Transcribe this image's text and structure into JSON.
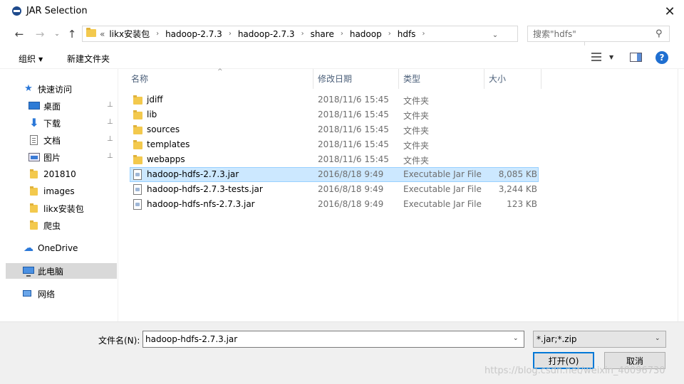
{
  "window": {
    "title": "JAR Selection",
    "close_glyph": "✕"
  },
  "nav": {
    "back_glyph": "←",
    "forward_glyph": "→",
    "recent_glyph": "⌄",
    "up_glyph": "↑",
    "refresh_glyph": "↻",
    "dropdown_glyph": "⌄"
  },
  "address": {
    "more_glyph": "«",
    "separator": "›",
    "crumbs": [
      "likx安装包",
      "hadoop-2.7.3",
      "hadoop-2.7.3",
      "share",
      "hadoop",
      "hdfs"
    ]
  },
  "search": {
    "placeholder": "搜索\"hdfs\"",
    "icon_glyph": "⚲"
  },
  "toolbar": {
    "organize_label": "组织",
    "organize_caret": "▼",
    "new_folder_label": "新建文件夹",
    "view_caret": "▼",
    "help_glyph": "?"
  },
  "sidebar": {
    "pin_glyph": "⊥",
    "quick_access": "快速访问",
    "items": [
      {
        "label": "桌面",
        "icon": "desktop-icon",
        "pinned": true
      },
      {
        "label": "下载",
        "icon": "download-icon",
        "pinned": true
      },
      {
        "label": "文档",
        "icon": "document-icon",
        "pinned": true
      },
      {
        "label": "图片",
        "icon": "pictures-icon",
        "pinned": true
      },
      {
        "label": "201810",
        "icon": "folder-icon",
        "pinned": false
      },
      {
        "label": "images",
        "icon": "folder-icon",
        "pinned": false
      },
      {
        "label": "likx安装包",
        "icon": "folder-icon",
        "pinned": false
      },
      {
        "label": "爬虫",
        "icon": "folder-icon",
        "pinned": false
      }
    ],
    "onedrive": "OneDrive",
    "this_pc": "此电脑",
    "network": "网络",
    "star_glyph": "★",
    "down_glyph": "⬇",
    "cloud_glyph": "☁"
  },
  "file_list": {
    "sort_glyph": "^",
    "columns": [
      "名称",
      "修改日期",
      "类型",
      "大小"
    ],
    "rows": [
      {
        "name": "jdiff",
        "date": "2018/11/6 15:45",
        "type": "文件夹",
        "size": "",
        "kind": "folder"
      },
      {
        "name": "lib",
        "date": "2018/11/6 15:45",
        "type": "文件夹",
        "size": "",
        "kind": "folder"
      },
      {
        "name": "sources",
        "date": "2018/11/6 15:45",
        "type": "文件夹",
        "size": "",
        "kind": "folder"
      },
      {
        "name": "templates",
        "date": "2018/11/6 15:45",
        "type": "文件夹",
        "size": "",
        "kind": "folder"
      },
      {
        "name": "webapps",
        "date": "2018/11/6 15:45",
        "type": "文件夹",
        "size": "",
        "kind": "folder"
      },
      {
        "name": "hadoop-hdfs-2.7.3.jar",
        "date": "2016/8/18 9:49",
        "type": "Executable Jar File",
        "size": "8,085 KB",
        "kind": "jar",
        "selected": true
      },
      {
        "name": "hadoop-hdfs-2.7.3-tests.jar",
        "date": "2016/8/18 9:49",
        "type": "Executable Jar File",
        "size": "3,244 KB",
        "kind": "jar"
      },
      {
        "name": "hadoop-hdfs-nfs-2.7.3.jar",
        "date": "2016/8/18 9:49",
        "type": "Executable Jar File",
        "size": "123 KB",
        "kind": "jar"
      }
    ]
  },
  "footer": {
    "filename_label": "文件名(N):",
    "filename_value": "hadoop-hdfs-2.7.3.jar",
    "filter_value": "*.jar;*.zip",
    "open_label": "打开(O)",
    "cancel_label": "取消",
    "caret_glyph": "⌄",
    "watermark": "https://blog.csdn.net/weixin_40096730"
  },
  "colors": {
    "selection_bg": "#cce8ff",
    "selection_border": "#99d1ff",
    "accent": "#0078d7",
    "folder": "#f3c94d"
  }
}
